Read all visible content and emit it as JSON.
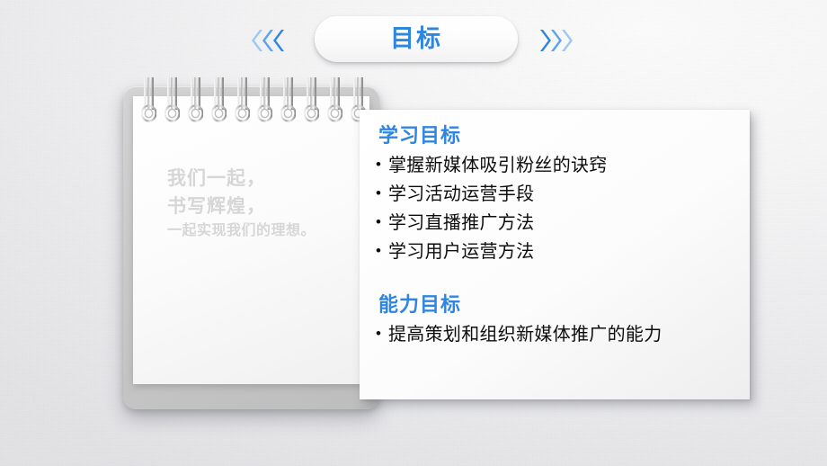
{
  "slide": {
    "background_color": "#ededef",
    "accent_color": "#2f86e0"
  },
  "header": {
    "title": "目标",
    "left_chevrons": {
      "icon": "chevron-left-icon",
      "count": 3,
      "colors": [
        "#9cc8f2",
        "#5ba3ea",
        "#2f86e0"
      ]
    },
    "right_chevrons": {
      "icon": "chevron-right-icon",
      "count": 3,
      "colors": [
        "#2f86e0",
        "#5ba3ea",
        "#9cc8f2"
      ]
    }
  },
  "notepad": {
    "spiral_ring_count": 10,
    "ring_icon": "spiral-ring-icon",
    "lines": [
      "我们一起，",
      "书写辉煌，",
      "一起实现我们的理想。"
    ],
    "text_color": "#d6d6d6"
  },
  "content": {
    "sections": [
      {
        "heading": "学习目标",
        "items": [
          "掌握新媒体吸引粉丝的诀窍",
          "学习活动运营手段",
          "学习直播推广方法",
          "学习用户运营方法"
        ]
      },
      {
        "heading": "能力目标",
        "items": [
          "提高策划和组织新媒体推广的能力"
        ]
      }
    ]
  }
}
